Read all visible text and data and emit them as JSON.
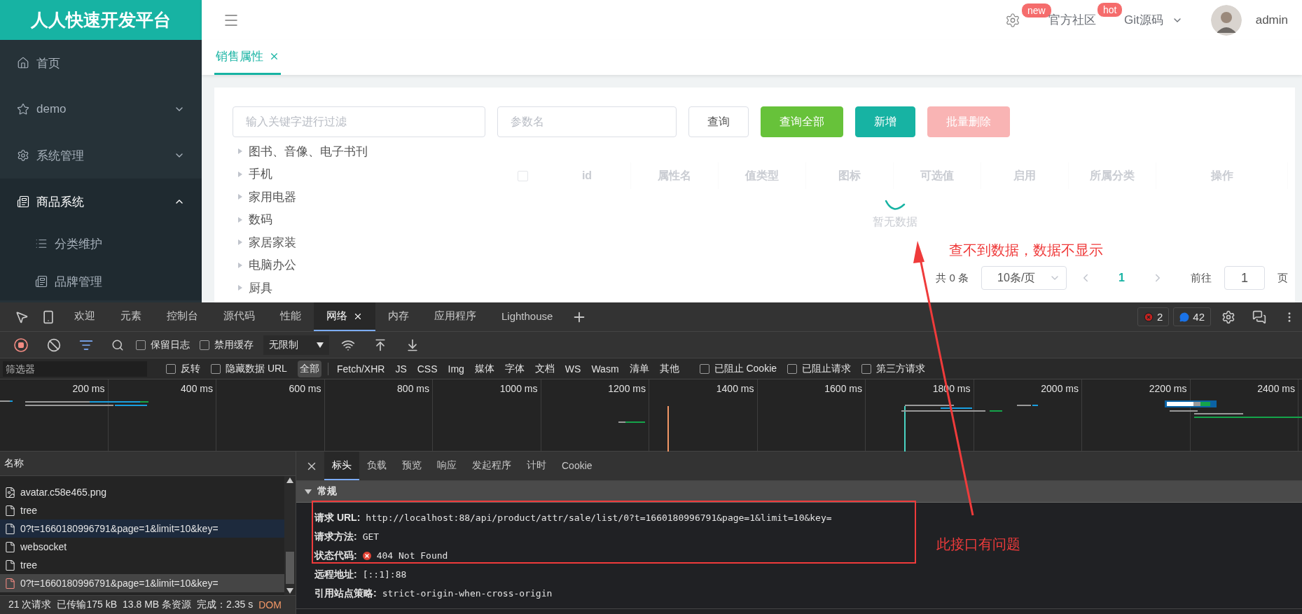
{
  "sidebar": {
    "title": "人人快速开发平台",
    "items": [
      {
        "label": "首页",
        "kind": "home",
        "selected": false
      },
      {
        "label": "demo",
        "kind": "star",
        "selected": false,
        "expanded": false
      },
      {
        "label": "系统管理",
        "kind": "gear",
        "selected": false,
        "expanded": false
      },
      {
        "label": "商品系统",
        "kind": "doc",
        "selected": true,
        "expanded": true,
        "children": [
          {
            "label": "分类维护",
            "kind": "list"
          },
          {
            "label": "品牌管理",
            "kind": "doc"
          }
        ]
      }
    ]
  },
  "header": {
    "links": [
      {
        "kind": "settings",
        "badge": "new"
      },
      {
        "kind": "text",
        "label": "官方社区",
        "badge": "hot"
      },
      {
        "kind": "dropdown",
        "label": "Git源码"
      }
    ],
    "user": "admin"
  },
  "tabs": [
    {
      "label": "销售属性",
      "selected": true
    }
  ],
  "filters": {
    "tree_filter": {
      "placeholder": "输入关键字进行过滤"
    },
    "param": {
      "placeholder": "参数名"
    },
    "buttons": [
      {
        "label": "查询",
        "kind": "default",
        "disabled": false
      },
      {
        "label": "查询全部",
        "kind": "success",
        "disabled": false
      },
      {
        "label": "新增",
        "kind": "primary",
        "disabled": false
      },
      {
        "label": "批量删除",
        "kind": "danger",
        "disabled": true
      }
    ]
  },
  "tree": [
    "图书、音像、电子书刊",
    "手机",
    "家用电器",
    "数码",
    "家居家装",
    "电脑办公",
    "厨具"
  ],
  "table": {
    "select_all": {
      "checked": false
    },
    "columns": [
      "id",
      "属性名",
      "值类型",
      "图标",
      "可选值",
      "启用",
      "所属分类",
      "操作"
    ],
    "loading": true,
    "empty_text": "暂无数据"
  },
  "pagination": {
    "total": "共 0 条",
    "page_size": "10条/页",
    "pages": [
      {
        "label": "1",
        "selected": true
      }
    ],
    "goto_label": "前往",
    "goto_value": "1",
    "goto_suffix": "页"
  },
  "annotations": {
    "note_top": "查不到数据，数据不显示",
    "note_bottom": "此接口有问题"
  },
  "devtools": {
    "tabs": [
      {
        "label": "欢迎",
        "selected": false
      },
      {
        "label": "元素",
        "selected": false
      },
      {
        "label": "控制台",
        "selected": false
      },
      {
        "label": "源代码",
        "selected": false
      },
      {
        "label": "性能",
        "selected": false
      },
      {
        "label": "网络",
        "selected": true
      },
      {
        "label": "内存",
        "selected": false
      },
      {
        "label": "应用程序",
        "selected": false
      },
      {
        "label": "Lighthouse",
        "selected": false
      }
    ],
    "errors": "2",
    "messages": "42",
    "toolbar": {
      "recording": true,
      "checkboxes": [
        {
          "label": "保留日志",
          "checked": false
        },
        {
          "label": "禁用缓存",
          "checked": false
        }
      ],
      "throttle": "无限制"
    },
    "filter_bar": {
      "placeholder": "筛选器",
      "checkboxes": [
        {
          "label": "反转",
          "checked": false
        },
        {
          "label": "隐藏数据 URL",
          "checked": false
        }
      ],
      "types": [
        {
          "label": "全部",
          "selected": true
        },
        {
          "label": "Fetch/XHR",
          "selected": false
        },
        {
          "label": "JS",
          "selected": false
        },
        {
          "label": "CSS",
          "selected": false
        },
        {
          "label": "Img",
          "selected": false
        },
        {
          "label": "媒体",
          "selected": false
        },
        {
          "label": "字体",
          "selected": false
        },
        {
          "label": "文档",
          "selected": false
        },
        {
          "label": "WS",
          "selected": false
        },
        {
          "label": "Wasm",
          "selected": false
        },
        {
          "label": "清单",
          "selected": false
        },
        {
          "label": "其他",
          "selected": false
        }
      ],
      "more_checkboxes": [
        {
          "label": "已阻止 Cookie",
          "checked": false
        },
        {
          "label": "已阻止请求",
          "checked": false
        },
        {
          "label": "第三方请求",
          "checked": false
        }
      ]
    },
    "timeline_ticks": [
      "200 ms",
      "400 ms",
      "600 ms",
      "800 ms",
      "1000 ms",
      "1200 ms",
      "1400 ms",
      "1600 ms",
      "1800 ms",
      "2000 ms",
      "2200 ms",
      "2400 ms"
    ],
    "requests": {
      "header": "名称",
      "rows": [
        {
          "name": "avatar.c58e465.png",
          "kind": "image",
          "selected": false,
          "highlighted": false,
          "error": false
        },
        {
          "name": "tree",
          "kind": "doc",
          "selected": false,
          "highlighted": false,
          "error": false
        },
        {
          "name": "0?t=1660180996791&page=1&limit=10&key=",
          "kind": "doc",
          "selected": false,
          "highlighted": true,
          "error": false
        },
        {
          "name": "websocket",
          "kind": "doc",
          "selected": false,
          "highlighted": false,
          "error": false
        },
        {
          "name": "tree",
          "kind": "doc",
          "selected": false,
          "highlighted": false,
          "error": false
        },
        {
          "name": "0?t=1660180996791&page=1&limit=10&key=",
          "kind": "doc",
          "selected": true,
          "highlighted": false,
          "error": true
        }
      ]
    },
    "status": [
      "21 次请求",
      "已传输175 kB",
      "13.8 MB 条资源",
      "完成：2.35 s",
      "DOM"
    ],
    "detail": {
      "tabs": [
        {
          "label": "标头",
          "selected": true
        },
        {
          "label": "负载",
          "selected": false
        },
        {
          "label": "预览",
          "selected": false
        },
        {
          "label": "响应",
          "selected": false
        },
        {
          "label": "发起程序",
          "selected": false
        },
        {
          "label": "计时",
          "selected": false
        },
        {
          "label": "Cookie",
          "selected": false
        }
      ],
      "section": {
        "title": "常规",
        "expanded": true,
        "rows": [
          {
            "key": "请求 URL:",
            "value": "http://localhost:88/api/product/attr/sale/list/0?t=1660180996791&page=1&limit=10&key=",
            "error": false
          },
          {
            "key": "请求方法:",
            "value": "GET",
            "error": false
          },
          {
            "key": "状态代码:",
            "value": "404 Not Found",
            "error": true
          },
          {
            "key": "远程地址:",
            "value": "[::1]:88",
            "error": false
          },
          {
            "key": "引用站点策略:",
            "value": "strict-origin-when-cross-origin",
            "error": false
          }
        ]
      }
    }
  }
}
